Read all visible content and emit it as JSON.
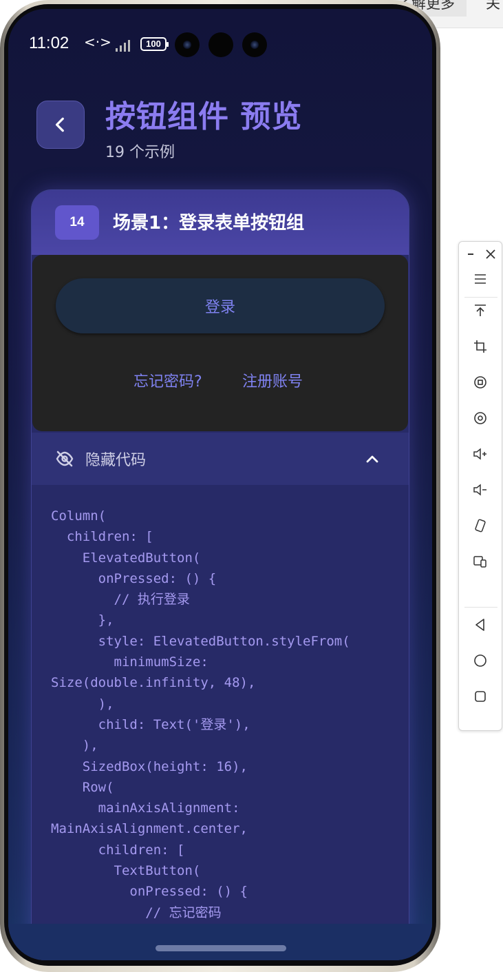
{
  "status_bar": {
    "time": "11:02",
    "code_icon": "<·>",
    "battery": "100"
  },
  "header": {
    "title": "按钮组件 预览",
    "subtitle": "19 个示例"
  },
  "card": {
    "number": "14",
    "title": "场景1：登录表单按钮组",
    "preview": {
      "login_label": "登录",
      "forgot_label": "忘记密码?",
      "register_label": "注册账号"
    },
    "code_toggle_label": "隐藏代码",
    "code": "Column(\n  children: [\n    ElevatedButton(\n      onPressed: () {\n        // 执行登录\n      },\n      style: ElevatedButton.styleFrom(\n        minimumSize:\nSize(double.infinity, 48),\n      ),\n      child: Text('登录'),\n    ),\n    SizedBox(height: 16),\n    Row(\n      mainAxisAlignment:\nMainAxisAlignment.center,\n      children: [\n        TextButton(\n          onPressed: () {\n            // 忘记密码"
  },
  "desktop": {
    "button_label": "了解更多",
    "extra_label": "关"
  },
  "colors": {
    "accent": "#8b7cf0",
    "link": "#7f82f0",
    "code": "#a59af0",
    "card_header": "#4b46a6"
  },
  "toolbar_icons": [
    "minimize-icon",
    "close-icon",
    "menu-icon",
    "pin-top-icon",
    "crop-icon",
    "screenshot-icon",
    "record-icon",
    "volume-up-icon",
    "volume-down-icon",
    "rotate-icon",
    "multi-screen-icon",
    "back-icon",
    "home-icon",
    "recents-icon"
  ]
}
